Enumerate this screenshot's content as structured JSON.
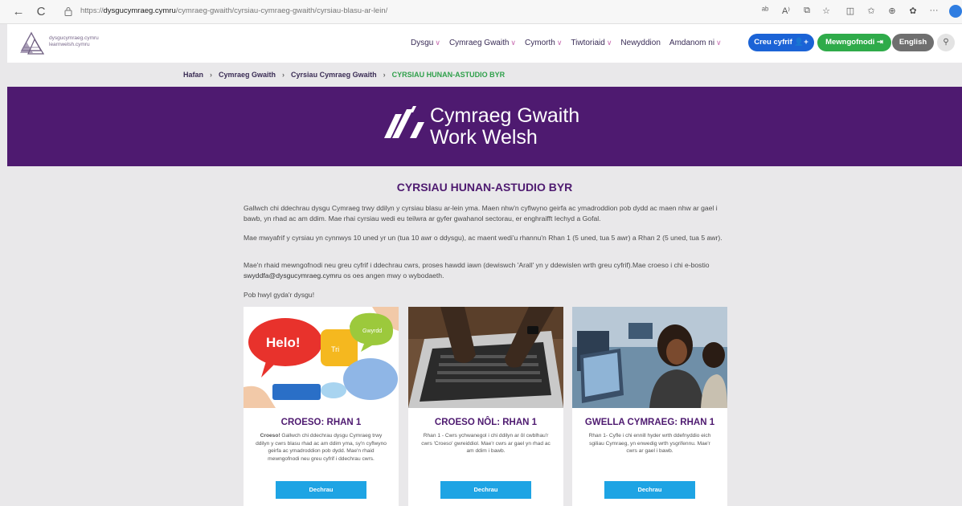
{
  "browser": {
    "url_prefix": "https://",
    "url_domain": "dysgucymraeg.cymru",
    "url_path": "/cymraeg-gwaith/cyrsiau-cymraeg-gwaith/cyrsiau-blasu-ar-lein/",
    "back": "←",
    "reload": "C",
    "icons": [
      "translate-icon",
      "read-aloud-icon",
      "split-screen-icon",
      "favorite-icon",
      "sidebar-icon",
      "favorites-list-icon",
      "collections-icon",
      "extensions-icon",
      "more-icon"
    ]
  },
  "header": {
    "logo_line1": "dysgucymraeg.cymru",
    "logo_line2": "learnwelsh.cymru",
    "menu": [
      {
        "label": "Dysgu",
        "chevron": true
      },
      {
        "label": "Cymraeg Gwaith",
        "chevron": true
      },
      {
        "label": "Cymorth",
        "chevron": true
      },
      {
        "label": "Tiwtoriaid",
        "chevron": true
      },
      {
        "label": "Newyddion",
        "chevron": false
      },
      {
        "label": "Amdanom ni",
        "chevron": true
      }
    ],
    "create_account": "Creu cyfrif",
    "login": "Mewngofnodi",
    "language": "English"
  },
  "breadcrumb": {
    "home": "Hafan",
    "level1": "Cymraeg Gwaith",
    "level2": "Cyrsiau Cymraeg Gwaith",
    "current": "CYRSIAU HUNAN-ASTUDIO BYR"
  },
  "hero": {
    "title_line1": "Cymraeg Gwaith",
    "title_line2": "Work Welsh"
  },
  "main": {
    "title": "CYRSIAU HUNAN-ASTUDIO BYR",
    "para1": "Gallwch chi ddechrau dysgu Cymraeg trwy ddilyn y cyrsiau blasu ar-lein yma.  Maen nhw'n cyflwyno geirfa ac ymadroddion pob dydd ac maen nhw ar gael i bawb, yn rhad ac am ddim.  Mae rhai cyrsiau wedi eu teilwra ar gyfer gwahanol sectorau, er enghraifft Iechyd a Gofal.",
    "para2": "Mae mwyafrif y cyrsiau yn cynnwys 10 uned yr un (tua 10 awr o ddysgu), ac maent wedi'u rhannu'n Rhan 1 (5 uned, tua 5 awr) a Rhan 2 (5 uned, tua 5 awr).",
    "para3_a": "Mae'n rhaid mewngofnodi neu greu cyfrif i ddechrau cwrs, proses hawdd iawn (dewiswch 'Arall' yn y ddewislen wrth greu cyfrif).Mae croeso i chi e-bostio ",
    "para3_email": "swyddfa@dysgucymraeg.cymru",
    "para3_b": " os oes angen mwy o wybodaeth.",
    "para4": "Pob hwyl gyda'r dysgu!"
  },
  "cards": [
    {
      "title": "CROESO: RHAN 1",
      "desc_bold": "Croeso!",
      "desc": " Gallwch chi ddechrau dysgu Cymraeg trwy ddilyn y cwrs blasu rhad ac am ddim yma, sy'n cyflwyno geirfa ac ymadroddion pob dydd. Mae'n rhaid mewngofnodi neu greu cyfrif i ddechrau cwrs.",
      "button": "Dechrau",
      "bubbles": [
        "Helo!",
        "Tri",
        "Gwyrdd"
      ]
    },
    {
      "title": "CROESO NÔL: RHAN 1",
      "desc_bold": "",
      "desc": "Rhan 1 - Cwrs ychwanegol i chi ddilyn ar ôl cwblhau'r cwrs 'Croeso' gwreiddiol. Mae'r cwrs ar gael yn rhad ac am ddim i bawb.",
      "button": "Dechrau"
    },
    {
      "title": "GWELLA CYMRAEG: RHAN 1",
      "desc_bold": "",
      "desc": "Rhan 1- Cyfle i chi ennill hyder wrth ddefnyddio eich sgiliau Cymraeg, yn enwedig wrth ysgrifennu. Mae'r cwrs ar gael i bawb.",
      "button": "Dechrau"
    }
  ],
  "colors": {
    "brand_purple": "#4e1a70",
    "accent_green": "#2fa04b",
    "button_blue": "#1ea4e4",
    "create_blue": "#1b63d6"
  }
}
